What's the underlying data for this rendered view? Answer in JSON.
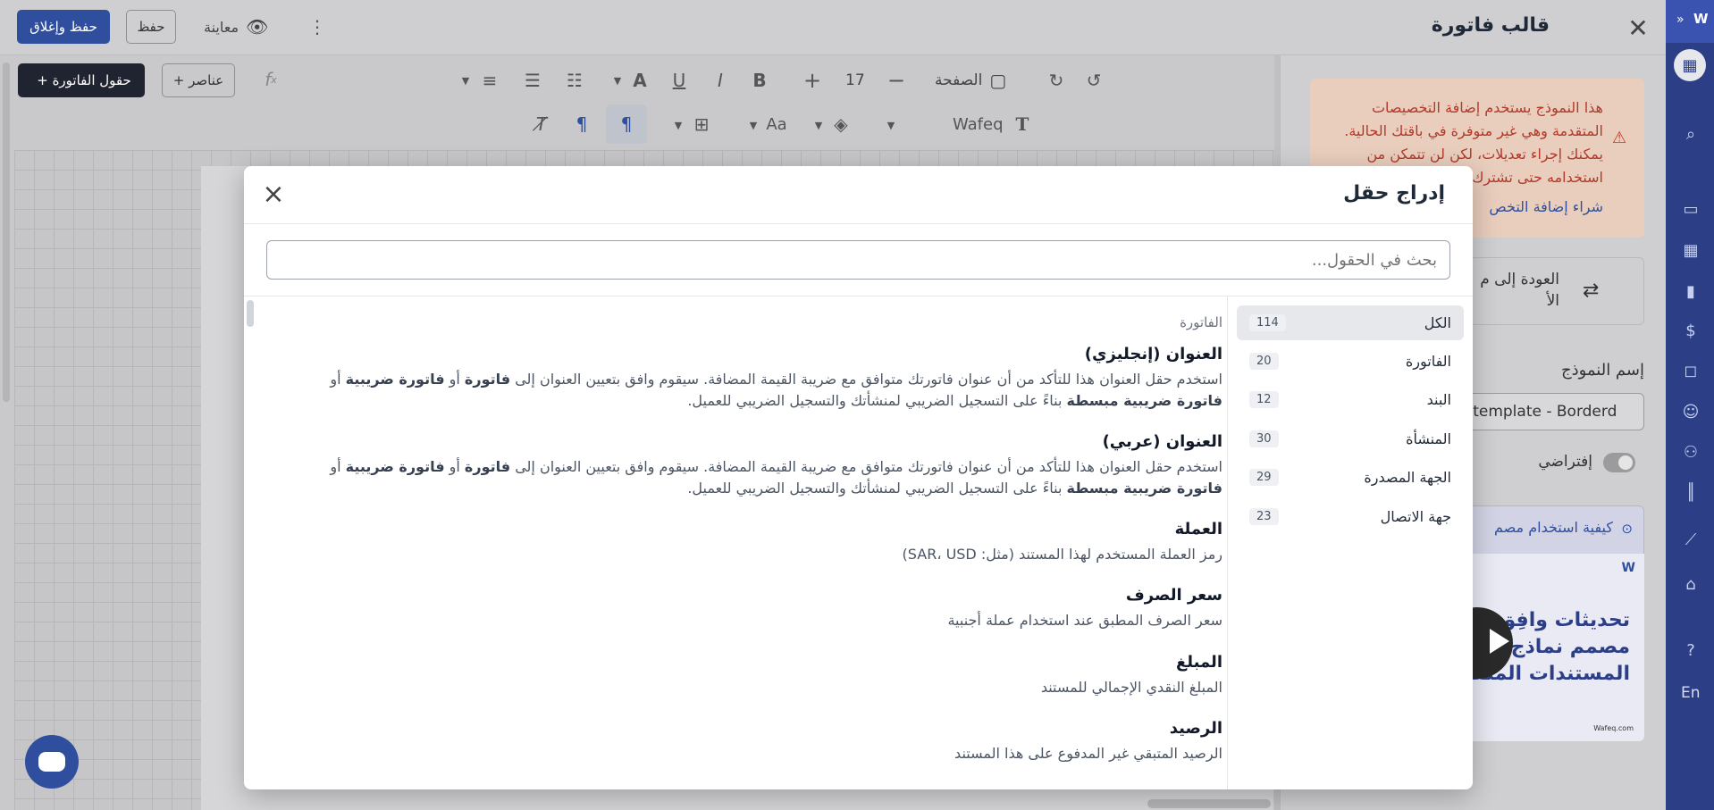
{
  "header": {
    "title": "قالب فاتورة",
    "save_close": "حفظ وإغلاق",
    "save": "حفظ",
    "preview": "معاينة"
  },
  "toolbar": {
    "invoice_fields": "حقول الفاتورة",
    "elements": "عناصر",
    "font_size": "17",
    "page": "الصفحة",
    "font_name": "Wafeq"
  },
  "warning": {
    "lines": [
      "هذا النموذج يستخدم إضافة التخصيصات",
      "المتقدمة وهي غير متوفرة في باقتك الحالية.",
      "يمكنك إجراء تعديلات، لكن لن تتمكن من",
      "استخدامه حتى تشترك"
    ],
    "link": "شراء إضافة التخص"
  },
  "right_panel": {
    "back_line1": "العودة إلى م",
    "back_line2": "الأ",
    "template_name_label": "إسم النموذج",
    "template_name_value": "ce template - Borderd",
    "default_label": "إفتراضي",
    "howto_link": "كيفية استخدام مصم",
    "video_text1": "تحديثات وافِق",
    "video_text2": "مصمم نماذج",
    "video_text3": "المستندات المتقدم",
    "video_footer": "Wafeq.com"
  },
  "sidebar": {
    "lang": "En"
  },
  "modal": {
    "title": "إدراج حقل",
    "search_placeholder": "بحث في الحقول...",
    "categories": [
      {
        "label": "الكل",
        "count": "114"
      },
      {
        "label": "الفاتورة",
        "count": "20"
      },
      {
        "label": "البند",
        "count": "12"
      },
      {
        "label": "المنشأة",
        "count": "30"
      },
      {
        "label": "الجهة المصدرة",
        "count": "29"
      },
      {
        "label": "جهة الاتصال",
        "count": "23"
      }
    ],
    "section": "الفاتورة",
    "fields": [
      {
        "title": "العنوان (إنجليزي)",
        "desc_a": "استخدم حقل العنوان هذا للتأكد من أن عنوان فاتورتك متوافق مع ضريبة القيمة المضافة. سيقوم وافق بتعيين العنوان إلى ",
        "desc_b1": "فاتورة",
        "desc_or": " أو ",
        "desc_b2": "فاتورة ضريبية",
        "desc_or2": " أو",
        "desc_b3": "فاتورة ضريبية مبسطة",
        "desc_c": " بناءً على التسجيل الضريبي لمنشأتك والتسجيل الضريبي للعميل."
      },
      {
        "title": "العنوان (عربي)",
        "desc_a": "استخدم حقل العنوان هذا للتأكد من أن عنوان فاتورتك متوافق مع ضريبة القيمة المضافة. سيقوم وافق بتعيين العنوان إلى ",
        "desc_b1": "فاتورة",
        "desc_or": " أو ",
        "desc_b2": "فاتورة ضريبية",
        "desc_or2": " أو",
        "desc_b3": "فاتورة ضريبية مبسطة",
        "desc_c": " بناءً على التسجيل الضريبي لمنشأتك والتسجيل الضريبي للعميل."
      },
      {
        "title": "العملة",
        "desc": "رمز العملة المستخدم لهذا المستند (مثل: SAR، USD)"
      },
      {
        "title": "سعر الصرف",
        "desc": "سعر الصرف المطبق عند استخدام عملة أجنبية"
      },
      {
        "title": "المبلغ",
        "desc": "المبلغ النقدي الإجمالي للمستند"
      },
      {
        "title": "الرصيد",
        "desc": "الرصيد المتبقي غير المدفوع على هذا المستند"
      }
    ]
  }
}
